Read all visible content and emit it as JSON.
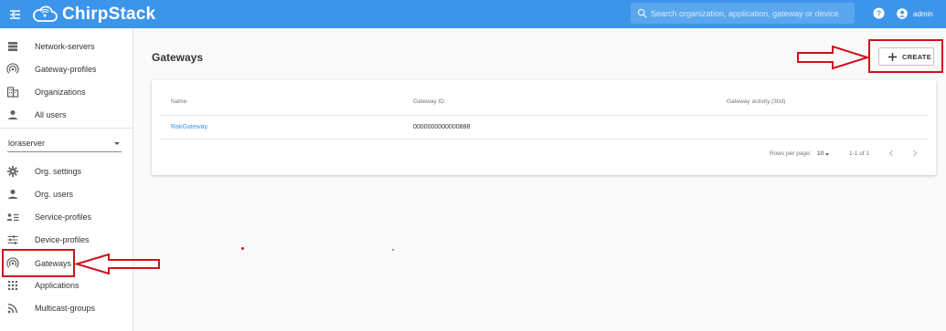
{
  "topbar": {
    "brand": "ChirpStack",
    "search_placeholder": "Search organization, application, gateway or device",
    "user": "admin"
  },
  "sidebar": {
    "admin_items": [
      {
        "label": "Network-servers",
        "icon": "server-icon"
      },
      {
        "label": "Gateway-profiles",
        "icon": "antenna-icon"
      },
      {
        "label": "Organizations",
        "icon": "building-icon"
      },
      {
        "label": "All users",
        "icon": "person-icon"
      }
    ],
    "org_select_value": "loraserver",
    "org_items": [
      {
        "label": "Org. settings",
        "icon": "gear-icon"
      },
      {
        "label": "Org. users",
        "icon": "person-icon"
      },
      {
        "label": "Service-profiles",
        "icon": "list-person-icon"
      },
      {
        "label": "Device-profiles",
        "icon": "sliders-icon"
      },
      {
        "label": "Gateways",
        "icon": "antenna-icon"
      },
      {
        "label": "Applications",
        "icon": "grid-icon"
      },
      {
        "label": "Multicast-groups",
        "icon": "rss-icon"
      }
    ]
  },
  "main": {
    "title": "Gateways",
    "create_label": "CREATE",
    "table": {
      "columns": [
        "Name",
        "Gateway ID",
        "Gateway activity (30d)"
      ],
      "rows": [
        {
          "name": "RakGateway",
          "gateway_id": "0000000000000888",
          "activity": ""
        }
      ],
      "rows_per_page_label": "Rows per page:",
      "rows_per_page_value": "10",
      "range": "1-1 of 1"
    }
  },
  "colors": {
    "topbar": "#3c95ea",
    "annotation": "#d0111b",
    "link": "#3c95ea"
  }
}
